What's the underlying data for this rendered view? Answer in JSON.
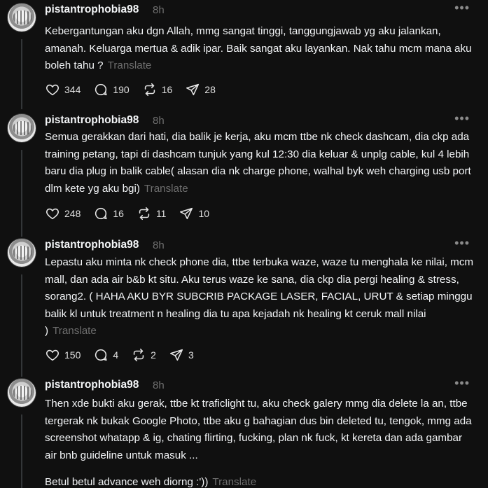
{
  "posts": [
    {
      "username": "pistantrophobia98",
      "time": "8h",
      "text": "Kebergantungan aku dgn Allah, mmg sangat tinggi, tanggungjawab yg aku jalankan, amanah. Keluarga mertua & adik ipar. Baik sangat aku layankan. Nak tahu mcm mana aku boleh tahu ?",
      "translate": "Translate",
      "likes": "344",
      "replies": "190",
      "reposts": "16",
      "shares": "28"
    },
    {
      "username": "pistantrophobia98",
      "time": "8h",
      "text": "Semua gerakkan dari hati, dia balik je kerja, aku mcm ttbe nk check dashcam, dia ckp ada training petang, tapi di dashcam tunjuk yang kul 12:30 dia keluar & unplg cable, kul 4 lebih baru dia plug in balik cable( alasan dia nk charge phone, walhal byk weh charging usb port dlm kete yg aku bgi)",
      "translate": "Translate",
      "likes": "248",
      "replies": "16",
      "reposts": "11",
      "shares": "10"
    },
    {
      "username": "pistantrophobia98",
      "time": "8h",
      "text": "Lepastu aku minta nk check phone dia, ttbe terbuka waze, waze tu menghala ke nilai, mcm mall, dan ada air b&b kt situ. Aku terus waze ke sana, dia ckp dia pergi healing & stress, sorang2. ( HAHA AKU BYR SUBCRIB PACKAGE LASER, FACIAL, URUT & setiap minggu balik kl untuk treatment n healing dia tu apa kejadah nk healing kt ceruk mall nilai )",
      "translate": "Translate",
      "likes": "150",
      "replies": "4",
      "reposts": "2",
      "shares": "3"
    },
    {
      "username": "pistantrophobia98",
      "time": "8h",
      "text": "Then xde bukti aku gerak, ttbe kt traficlight tu, aku check galery mmg dia delete la an, ttbe tergerak nk bukak Google Photo, ttbe aku g bahagian dus bin deleted tu, tengok, mmg ada screenshot whatapp & ig, chating flirting, fucking, plan nk fuck, kt kereta dan ada gambar air bnb guideline untuk masuk ...",
      "text2": "Betul betul advance weh diorng :'))",
      "translate": "Translate"
    }
  ],
  "icons": {
    "like": "heart-icon",
    "reply": "comment-icon",
    "repost": "repost-icon",
    "share": "send-icon",
    "more": "more-icon"
  }
}
